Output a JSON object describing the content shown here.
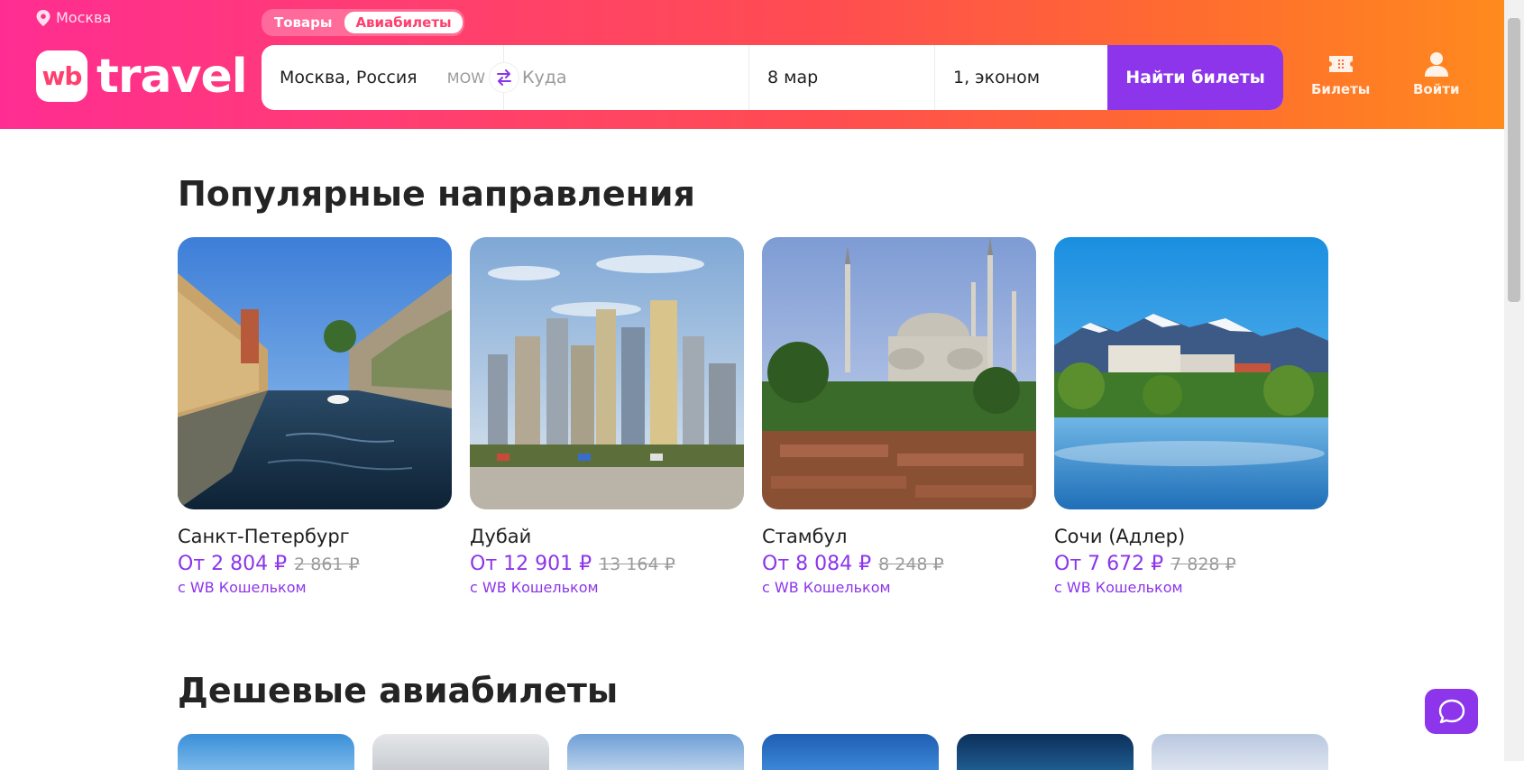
{
  "header": {
    "location": "Москва",
    "logo_badge": "wb",
    "logo_text": "travel",
    "tabs": [
      {
        "label": "Товары",
        "active": false
      },
      {
        "label": "Авиабилеты",
        "active": true
      }
    ],
    "search": {
      "from": "Москва, Россия",
      "from_code": "MOW",
      "to_placeholder": "Куда",
      "date": "8 мар",
      "passengers": "1, эконом",
      "submit": "Найти билеты"
    },
    "nav": {
      "tickets": "Билеты",
      "login": "Войти"
    }
  },
  "popular": {
    "title": "Популярные направления",
    "items": [
      {
        "city": "Санкт-Петербург",
        "price": "От 2 804 ₽",
        "old_price": "2 861 ₽",
        "note": "с WB Кошельком"
      },
      {
        "city": "Дубай",
        "price": "От 12 901 ₽",
        "old_price": "13 164 ₽",
        "note": "с WB Кошельком"
      },
      {
        "city": "Стамбул",
        "price": "От 8 084 ₽",
        "old_price": "8 248 ₽",
        "note": "с WB Кошельком"
      },
      {
        "city": "Сочи (Адлер)",
        "price": "От 7 672 ₽",
        "old_price": "7 828 ₽",
        "note": "с WB Кошельком"
      }
    ]
  },
  "cheap": {
    "title": "Дешевые авиабилеты"
  },
  "colors": {
    "accent": "#8c35ea",
    "header_from": "#ff2d92",
    "header_to": "#ff8a1e"
  },
  "icons": [
    "location-pin-icon",
    "swap-icon",
    "ticket-icon",
    "user-icon",
    "chat-icon"
  ]
}
